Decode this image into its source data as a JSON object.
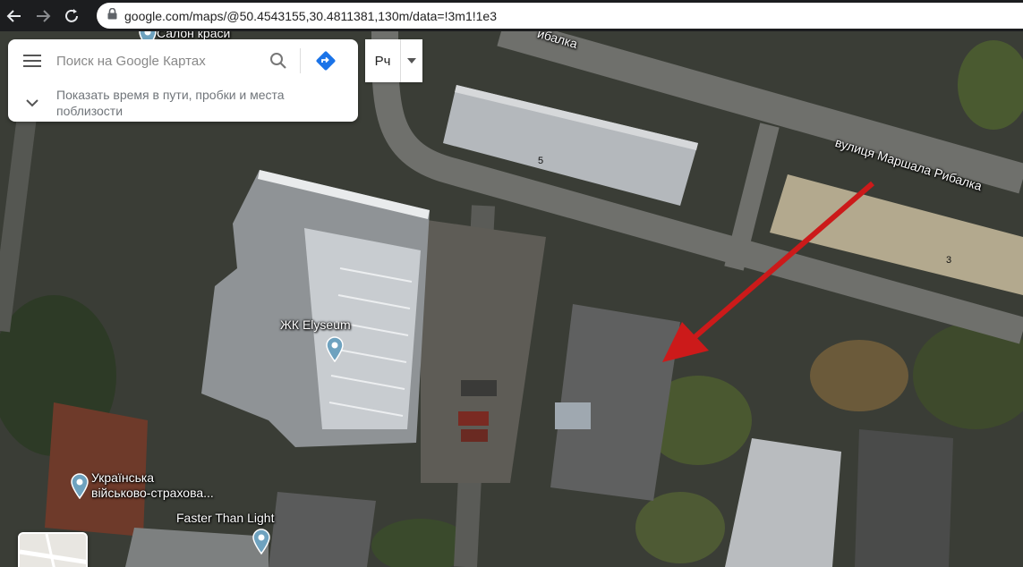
{
  "browser": {
    "url": "google.com/maps/@50.4543155,30.4811381,130m/data=!3m1!1e3",
    "icons": [
      "back-arrow-icon",
      "forward-arrow-icon",
      "reload-icon",
      "lock-icon"
    ]
  },
  "search": {
    "placeholder": "Поиск на Google Картах",
    "suggestion": "Показать время в пути, пробки и места поблизости",
    "icons": [
      "menu-icon",
      "search-icon",
      "directions-icon",
      "chevron-down-icon"
    ]
  },
  "lang_control": {
    "label": "Рч"
  },
  "map": {
    "street_label": "вулиця Маршала Рибалка",
    "street_label_top": "ибалка",
    "top_label": "Салон краси",
    "places": [
      {
        "name": "ЖК Elyseum"
      },
      {
        "name": "Українська військово-страхова..."
      },
      {
        "name": "Faster Than Light"
      }
    ],
    "place_line1": "Українська",
    "place_line2": "військово-страхова...",
    "building_numbers": [
      "5",
      "3"
    ],
    "annotation_color": "#cc1a1a"
  }
}
